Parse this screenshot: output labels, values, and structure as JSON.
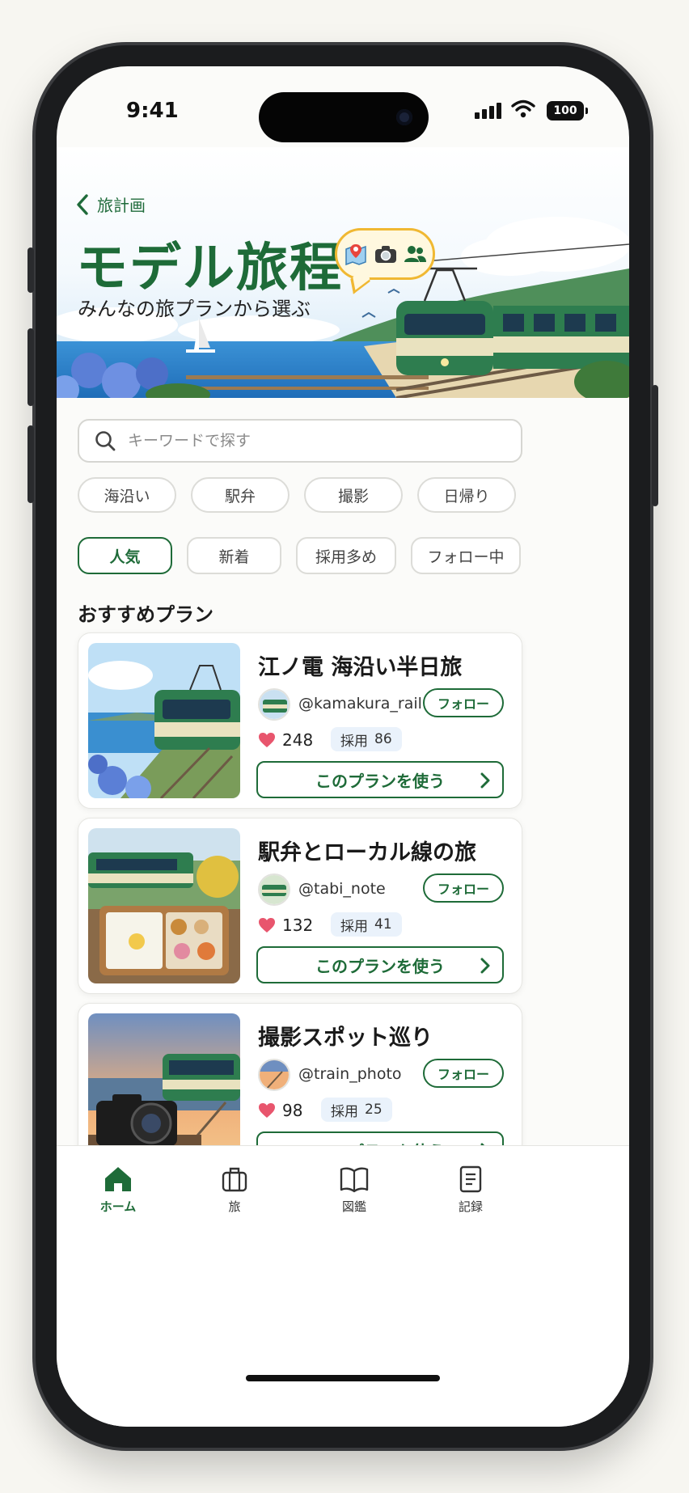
{
  "status": {
    "time": "9:41",
    "battery": "100"
  },
  "header": {
    "back_label": "旅計画",
    "title": "モデル旅程",
    "subtitle": "みんなの旅プランから選ぶ",
    "bubble_icons": [
      "map-pin-icon",
      "camera-icon",
      "people-icon"
    ]
  },
  "search": {
    "placeholder": "キーワードで探す",
    "value": ""
  },
  "filters": [
    "海沿い",
    "駅弁",
    "撮影",
    "日帰り"
  ],
  "sort": {
    "options": [
      "人気",
      "新着",
      "採用多め",
      "フォロー中"
    ],
    "active": "人気"
  },
  "section_title": "おすすめプラン",
  "plans": [
    {
      "title": "江ノ電 海沿い半日旅",
      "handle": "@kamakura_rail",
      "follow": "フォロー",
      "likes": "248",
      "adopt_label": "採用",
      "adopt": "86",
      "cta": "このプランを使う"
    },
    {
      "title": "駅弁とローカル線の旅",
      "handle": "@tabi_note",
      "follow": "フォロー",
      "likes": "132",
      "adopt_label": "採用",
      "adopt": "41",
      "cta": "このプランを使う"
    },
    {
      "title": "撮影スポット巡り",
      "handle": "@train_photo",
      "follow": "フォロー",
      "likes": "98",
      "adopt_label": "採用",
      "adopt": "25",
      "cta": "このプランを使う"
    }
  ],
  "tabs": [
    {
      "label": "ホーム",
      "icon": "home-icon",
      "active": true
    },
    {
      "label": "旅",
      "icon": "suitcase-icon",
      "active": false
    },
    {
      "label": "図鑑",
      "icon": "book-icon",
      "active": false
    },
    {
      "label": "記録",
      "icon": "document-icon",
      "active": false
    }
  ],
  "colors": {
    "accent": "#1e6b38",
    "heart": "#e8556d",
    "adopt_bg": "#eaf2fb",
    "bubble_border": "#f0b832"
  }
}
